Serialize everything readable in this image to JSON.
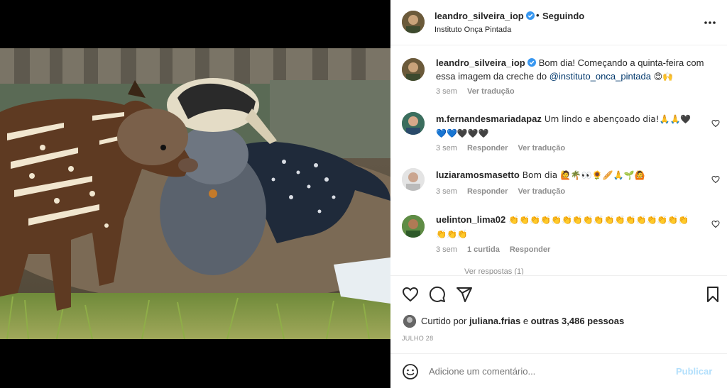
{
  "post": {
    "author": "leandro_silveira_iop",
    "separator": "•",
    "follow_status": "Seguindo",
    "location": "Instituto Onça Pintada"
  },
  "caption": {
    "author": "leandro_silveira_iop",
    "text": "Bom dia! Começando a quinta-feira com essa imagem da creche do ",
    "mention": "@instituto_onca_pintada",
    "emoji": "😍🙌",
    "time": "3 sem",
    "translate": "Ver tradução"
  },
  "comments": [
    {
      "user": "m.fernandesmariadapaz",
      "text": "Um lindo e abençoado dia!🙏🙏🖤",
      "text2": "💙💙🖤🖤🖤",
      "time": "3 sem",
      "reply": "Responder",
      "translate": "Ver tradução"
    },
    {
      "user": "luziaramosmasetto",
      "text": "Bom dia 🙋🌴👀🌻🥖🙏🌱🙆",
      "time": "3 sem",
      "reply": "Responder",
      "translate": "Ver tradução"
    },
    {
      "user": "uelinton_lima02",
      "text": "👏👏👏👏👏👏👏👏👏👏👏👏👏👏👏👏👏👏👏👏",
      "time": "3 sem",
      "likes": "1 curtida",
      "reply": "Responder",
      "view_replies": "Ver respostas (1)"
    }
  ],
  "likes": {
    "prefix": "Curtido por",
    "user": "juliana.frias",
    "joiner": "e",
    "others": "outras 3,486 pessoas"
  },
  "date": "JULHO 28",
  "add_comment": {
    "placeholder": "Adicione um comentário...",
    "publish": "Publicar"
  },
  "colors": {
    "verified": "#3897f0",
    "link": "#00376b",
    "muted": "#8e8e8e",
    "publish_disabled": "#b2dffc"
  },
  "icons": [
    "verified-badge-icon",
    "more-options-icon",
    "heart-icon",
    "comment-icon",
    "share-icon",
    "bookmark-icon",
    "emoji-icon"
  ]
}
